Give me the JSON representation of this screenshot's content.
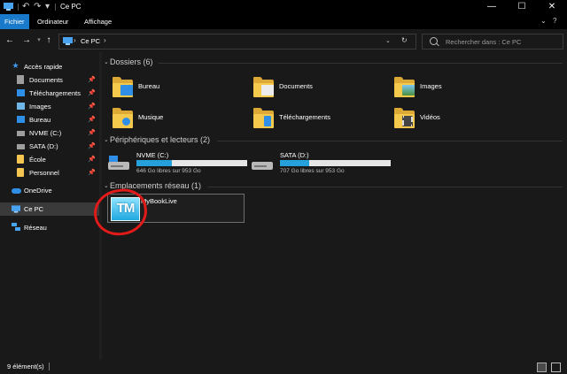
{
  "window": {
    "title": "Ce PC"
  },
  "ribbon": {
    "tabs": [
      "Fichier",
      "Ordinateur",
      "Affichage"
    ],
    "active_tab": "Fichier"
  },
  "address_bar": {
    "path": [
      "Ce PC"
    ]
  },
  "search": {
    "placeholder": "Rechercher dans : Ce PC"
  },
  "nav_pane": {
    "quick_access": {
      "label": "Accès rapide"
    },
    "pinned": [
      {
        "label": "Documents",
        "icon": "documents-icon",
        "pinned": true
      },
      {
        "label": "Téléchargements",
        "icon": "downloads-icon",
        "pinned": true
      },
      {
        "label": "Images",
        "icon": "pictures-icon",
        "pinned": true
      },
      {
        "label": "Bureau",
        "icon": "desktop-icon",
        "pinned": true
      },
      {
        "label": "NVME (C:)",
        "icon": "drive-icon",
        "pinned": true
      },
      {
        "label": "SATA (D:)",
        "icon": "drive-icon",
        "pinned": true
      },
      {
        "label": "École",
        "icon": "folder-icon",
        "pinned": true
      },
      {
        "label": "Personnel",
        "icon": "folder-icon",
        "pinned": true
      }
    ],
    "onedrive": {
      "label": "OneDrive"
    },
    "this_pc": {
      "label": "Ce PC",
      "selected": true
    },
    "network": {
      "label": "Réseau"
    }
  },
  "groups": {
    "folders": {
      "title": "Dossiers (6)",
      "items": [
        {
          "label": "Bureau",
          "icon": "desktop-folder-icon"
        },
        {
          "label": "Documents",
          "icon": "documents-folder-icon"
        },
        {
          "label": "Images",
          "icon": "pictures-folder-icon"
        },
        {
          "label": "Musique",
          "icon": "music-folder-icon"
        },
        {
          "label": "Téléchargements",
          "icon": "downloads-folder-icon"
        },
        {
          "label": "Vidéos",
          "icon": "videos-folder-icon"
        }
      ]
    },
    "devices": {
      "title": "Périphériques et lecteurs (2)",
      "drives": [
        {
          "name": "NVME (C:)",
          "free_text": "646 Go libres sur 953 Go",
          "used_fraction": 0.32
        },
        {
          "name": "SATA (D:)",
          "free_text": "707 Go libres sur 953 Go",
          "used_fraction": 0.26
        }
      ]
    },
    "network": {
      "title": "Emplacements réseau (1)",
      "items": [
        {
          "label": "MyBookLive",
          "icon_text": "TM"
        }
      ]
    }
  },
  "status_bar": {
    "count_text": "9 élément(s)"
  },
  "colors": {
    "accent": "#1979ca",
    "bar_fill": "#26a0da",
    "annotation": "#e11a1a"
  }
}
